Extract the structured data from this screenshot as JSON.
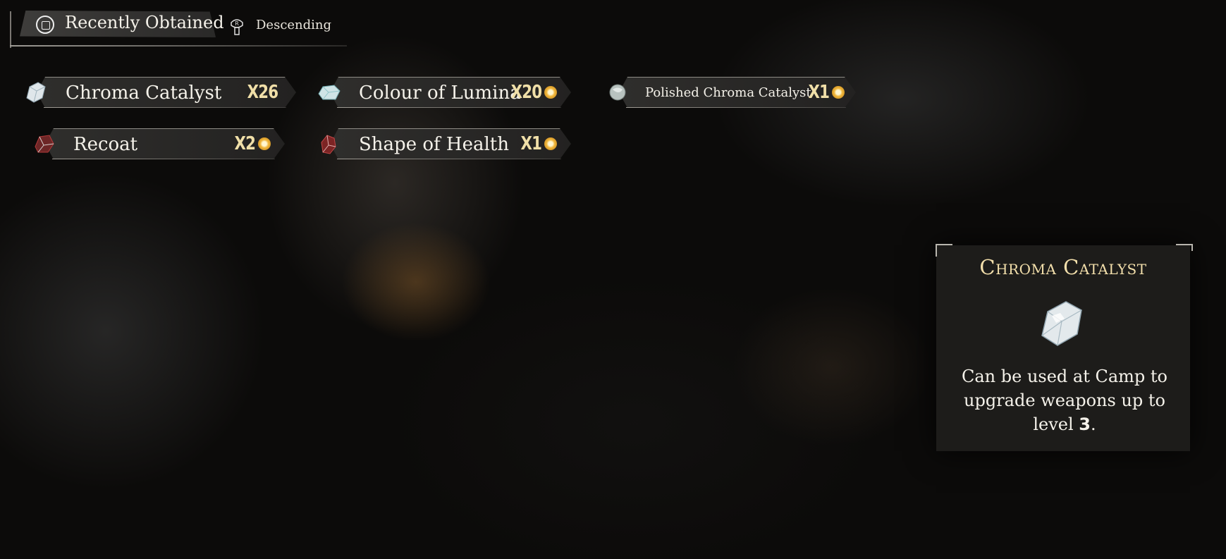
{
  "sort": {
    "label": "Recently Obtained",
    "order": "Descending",
    "sort_button_icon": "square-button-icon",
    "order_button_icon": "right-stick-icon"
  },
  "items": [
    {
      "name": "Chroma Catalyst",
      "qty": "X26",
      "icon": "chroma-catalyst-icon",
      "new": false
    },
    {
      "name": "Colour of Lumina",
      "qty": "X20",
      "icon": "colour-of-lumina-icon",
      "new": true
    },
    {
      "name": "Polished Chroma Catalyst",
      "qty": "X1",
      "icon": "polished-chroma-catalyst-icon",
      "new": true
    },
    {
      "name": "Recoat",
      "qty": "X2",
      "icon": "recoat-icon",
      "new": true
    },
    {
      "name": "Shape of Health",
      "qty": "X1",
      "icon": "shape-of-health-icon",
      "new": true
    }
  ],
  "detail": {
    "title": "Chroma Catalyst",
    "description_before": "Can be used at Camp to upgrade weapons up to level ",
    "level": "3",
    "description_after": "."
  },
  "colors": {
    "title_gold": "#f3dfab",
    "qty_gold": "#f0dfa8",
    "new_badge": "#f1b73b"
  }
}
